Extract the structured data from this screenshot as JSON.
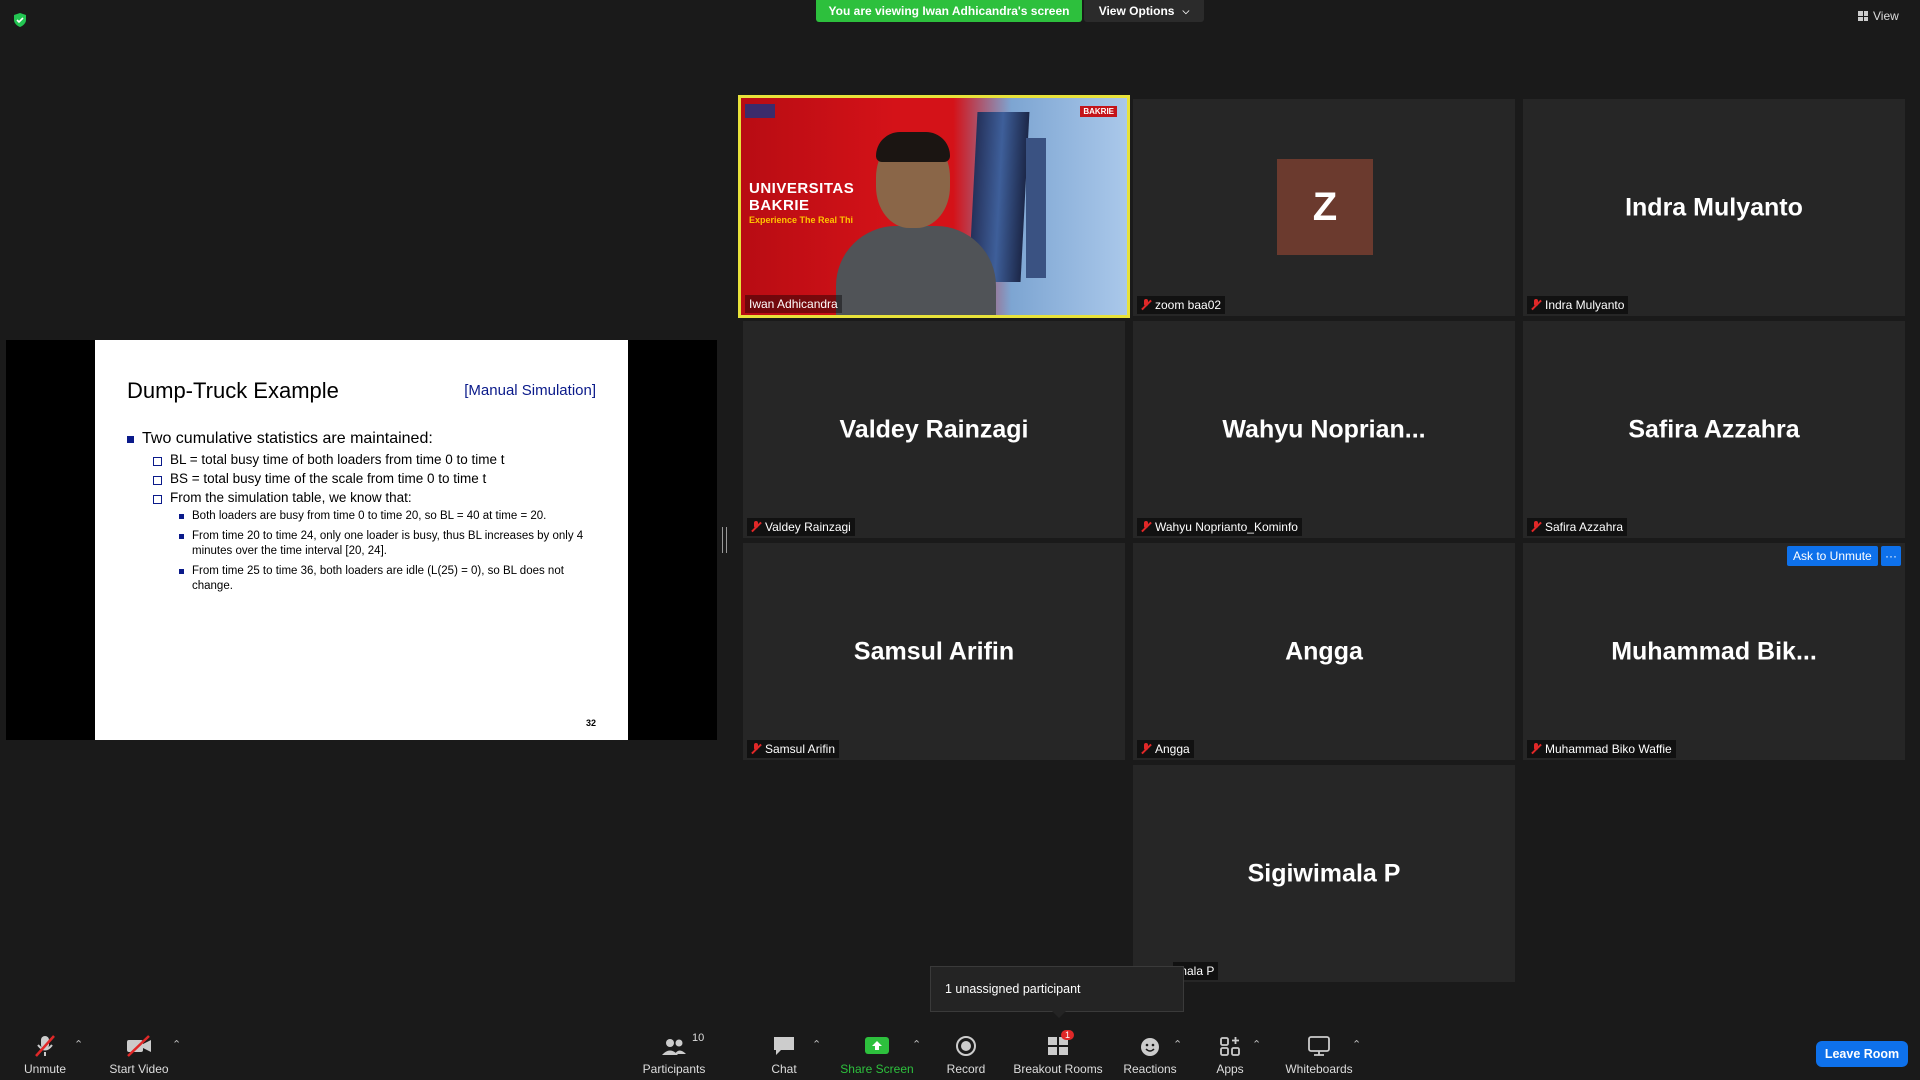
{
  "top": {
    "viewing_banner": "You are viewing Iwan Adhicandra's screen",
    "view_options": "View Options",
    "view": "View"
  },
  "slide": {
    "title": "Dump-Truck Example",
    "tag": "[Manual Simulation]",
    "bullet1": "Two cumulative statistics are maintained:",
    "sub1": "BL = total busy time of both loaders from time 0 to time t",
    "sub2": "BS = total busy time of the scale from time 0 to time t",
    "sub3": "From the simulation table, we know that:",
    "point1": "Both loaders are busy from time 0 to time 20, so BL = 40 at time = 20.",
    "point2": "From time 20 to time 24, only one loader is busy, thus BL increases by only 4 minutes over the time interval [20, 24].",
    "point3": "From time 25 to time 36, both loaders are idle (L(25) = 0), so BL does not change.",
    "page": "32"
  },
  "active_video": {
    "uni_line1": "UNIVERSITAS",
    "uni_line2": "BAKRIE",
    "uni_tagline": "Experience The Real Thi",
    "logo": "BAKRIE",
    "label": "Iwan Adhicandra"
  },
  "tiles": [
    {
      "center": "Z",
      "label": "zoom baa02"
    },
    {
      "center": "Indra Mulyanto",
      "label": "Indra Mulyanto"
    },
    {
      "center": "Valdey Rainzagi",
      "label": "Valdey Rainzagi"
    },
    {
      "center": "Wahyu  Noprian...",
      "label": "Wahyu Noprianto_Kominfo"
    },
    {
      "center": "Safira Azzahra",
      "label": "Safira Azzahra"
    },
    {
      "center": "Samsul Arifin",
      "label": "Samsul Arifin"
    },
    {
      "center": "Angga",
      "label": "Angga"
    },
    {
      "center": "Muhammad  Bik...",
      "label": "Muhammad Biko Waffie"
    },
    {
      "center": "Sigiwimala P",
      "label": "mala P"
    }
  ],
  "ask_to_unmute": "Ask to Unmute",
  "more": "···",
  "tooltip": "1 unassigned participant",
  "toolbar": {
    "unmute": "Unmute",
    "start_video": "Start Video",
    "participants": "Participants",
    "participants_count": "10",
    "chat": "Chat",
    "share_screen": "Share Screen",
    "record": "Record",
    "breakout_rooms": "Breakout Rooms",
    "breakout_badge": "1",
    "reactions": "Reactions",
    "apps": "Apps",
    "whiteboards": "Whiteboards",
    "leave_room": "Leave Room"
  },
  "colors": {
    "share_green": "#2dc03d",
    "zoom_blue": "#0e71eb",
    "active_border": "#e8e23a",
    "muted_red": "#e02828"
  }
}
